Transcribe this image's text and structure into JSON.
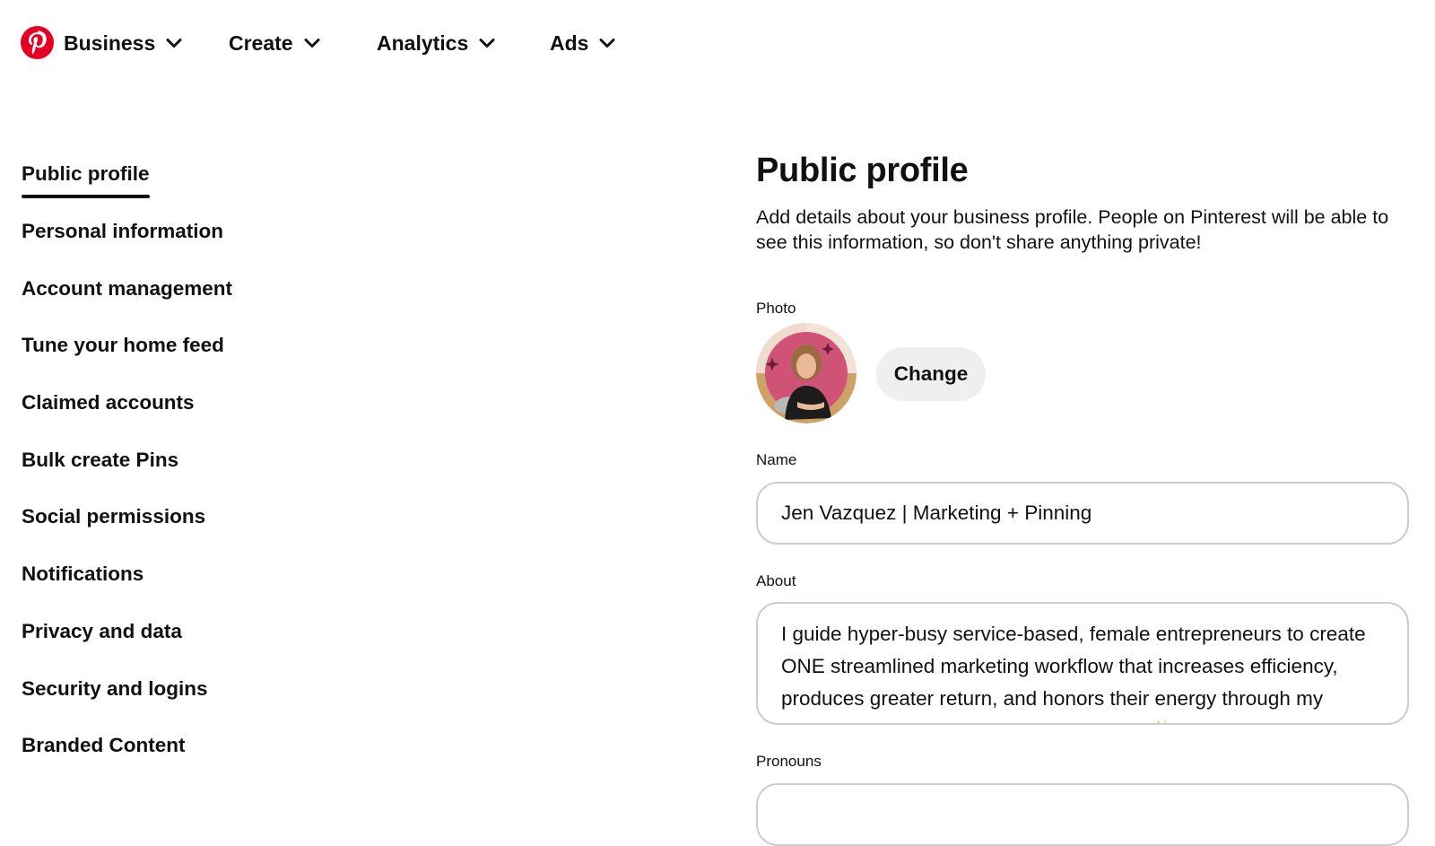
{
  "topnav": {
    "logo_icon": "pinterest-logo",
    "items": [
      {
        "label": "Business",
        "icon": "chevron-down-icon"
      },
      {
        "label": "Create",
        "icon": "chevron-down-icon"
      },
      {
        "label": "Analytics",
        "icon": "chevron-down-icon"
      },
      {
        "label": "Ads",
        "icon": "chevron-down-icon"
      }
    ]
  },
  "sidebar": {
    "active_index": 0,
    "items": [
      {
        "label": "Public profile"
      },
      {
        "label": "Personal information"
      },
      {
        "label": "Account management"
      },
      {
        "label": "Tune your home feed"
      },
      {
        "label": "Claimed accounts"
      },
      {
        "label": "Bulk create Pins"
      },
      {
        "label": "Social permissions"
      },
      {
        "label": "Notifications"
      },
      {
        "label": "Privacy and data"
      },
      {
        "label": "Security and logins"
      },
      {
        "label": "Branded Content"
      }
    ]
  },
  "main": {
    "title": "Public profile",
    "description": "Add details about your business profile. People on Pinterest will be able to see this information, so don't share anything private!",
    "photo": {
      "label": "Photo",
      "change_button": "Change"
    },
    "name": {
      "label": "Name",
      "value": "Jen Vazquez | Marketing + Pinning"
    },
    "about": {
      "label": "About",
      "value": "I guide hyper-busy service-based, female entrepreneurs to create ONE streamlined marketing workflow that increases efficiency, produces greater return, and honors their energy through my proven Pinterest + Repurposing Method. ✨What"
    },
    "pronouns": {
      "label": "Pronouns",
      "value": ""
    }
  },
  "colors": {
    "brand": "#e60023",
    "text": "#111111",
    "button_bg": "#efefef",
    "input_border": "#cdcdcd"
  }
}
